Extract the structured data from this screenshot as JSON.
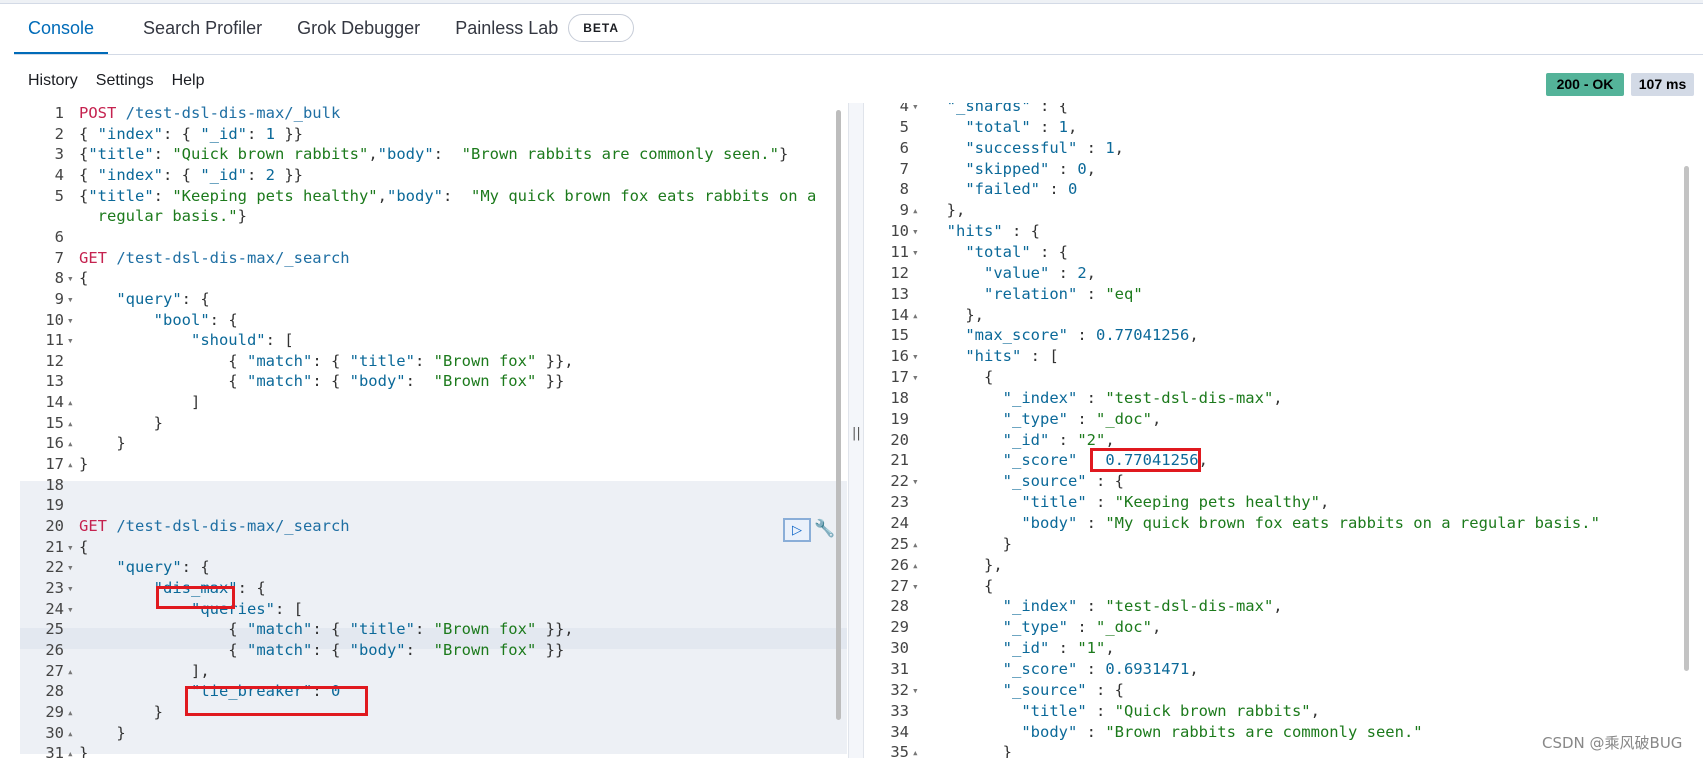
{
  "tabs": [
    {
      "label": "Console"
    },
    {
      "label": "Search Profiler"
    },
    {
      "label": "Grok Debugger"
    },
    {
      "label": "Painless Lab"
    }
  ],
  "beta_badge": "BETA",
  "toolbar": {
    "history": "History",
    "settings": "Settings",
    "help": "Help"
  },
  "status": {
    "code": "200 - OK",
    "time": "107 ms"
  },
  "splitter_grip": "||",
  "watermark": "CSDN @乘风破BUG",
  "icons": {
    "run": "play-icon",
    "wrench": "wrench-icon"
  },
  "colors": {
    "accent": "#006bb8",
    "ok": "#54b399",
    "highlight_box": "#e0191f"
  },
  "left_lines": [
    {
      "n": "1",
      "f": "",
      "t": [
        [
          "m",
          "POST"
        ],
        [
          "p",
          " /test-dsl-dis-max/_bulk"
        ]
      ]
    },
    {
      "n": "2",
      "f": "",
      "t": [
        [
          "b",
          "{ "
        ],
        [
          "k",
          "\"index\""
        ],
        [
          "b",
          ": { "
        ],
        [
          "k",
          "\"_id\""
        ],
        [
          "b",
          ": "
        ],
        [
          "n",
          "1"
        ],
        [
          "b",
          " }}"
        ]
      ]
    },
    {
      "n": "3",
      "f": "",
      "t": [
        [
          "b",
          "{"
        ],
        [
          "k",
          "\"title\""
        ],
        [
          "b",
          ": "
        ],
        [
          "s",
          "\"Quick brown rabbits\""
        ],
        [
          "b",
          ","
        ],
        [
          "k",
          "\"body\""
        ],
        [
          "b",
          ":  "
        ],
        [
          "s",
          "\"Brown rabbits are commonly seen.\""
        ],
        [
          "b",
          "}"
        ]
      ]
    },
    {
      "n": "4",
      "f": "",
      "t": [
        [
          "b",
          "{ "
        ],
        [
          "k",
          "\"index\""
        ],
        [
          "b",
          ": { "
        ],
        [
          "k",
          "\"_id\""
        ],
        [
          "b",
          ": "
        ],
        [
          "n",
          "2"
        ],
        [
          "b",
          " }}"
        ]
      ]
    },
    {
      "n": "5",
      "f": "",
      "t": [
        [
          "b",
          "{"
        ],
        [
          "k",
          "\"title\""
        ],
        [
          "b",
          ": "
        ],
        [
          "s",
          "\"Keeping pets healthy\""
        ],
        [
          "b",
          ","
        ],
        [
          "k",
          "\"body\""
        ],
        [
          "b",
          ":  "
        ],
        [
          "s",
          "\"My quick brown fox eats rabbits on a"
        ]
      ]
    },
    {
      "n": "",
      "f": "",
      "t": [
        [
          "s",
          "  regular basis.\""
        ],
        [
          "b",
          "}"
        ]
      ]
    },
    {
      "n": "6",
      "f": "",
      "t": []
    },
    {
      "n": "7",
      "f": "",
      "t": [
        [
          "m",
          "GET"
        ],
        [
          "p",
          " /test-dsl-dis-max/_search"
        ]
      ]
    },
    {
      "n": "8",
      "f": "▾",
      "t": [
        [
          "b",
          "{"
        ]
      ]
    },
    {
      "n": "9",
      "f": "▾",
      "t": [
        [
          "b",
          "    "
        ],
        [
          "k",
          "\"query\""
        ],
        [
          "b",
          ": {"
        ]
      ]
    },
    {
      "n": "10",
      "f": "▾",
      "t": [
        [
          "b",
          "        "
        ],
        [
          "k",
          "\"bool\""
        ],
        [
          "b",
          ": {"
        ]
      ]
    },
    {
      "n": "11",
      "f": "▾",
      "t": [
        [
          "b",
          "            "
        ],
        [
          "k",
          "\"should\""
        ],
        [
          "b",
          ": ["
        ]
      ]
    },
    {
      "n": "12",
      "f": "",
      "t": [
        [
          "b",
          "                { "
        ],
        [
          "k",
          "\"match\""
        ],
        [
          "b",
          ": { "
        ],
        [
          "k",
          "\"title\""
        ],
        [
          "b",
          ": "
        ],
        [
          "s",
          "\"Brown fox\""
        ],
        [
          "b",
          " }},"
        ]
      ]
    },
    {
      "n": "13",
      "f": "",
      "t": [
        [
          "b",
          "                { "
        ],
        [
          "k",
          "\"match\""
        ],
        [
          "b",
          ": { "
        ],
        [
          "k",
          "\"body\""
        ],
        [
          "b",
          ":  "
        ],
        [
          "s",
          "\"Brown fox\""
        ],
        [
          "b",
          " }}"
        ]
      ]
    },
    {
      "n": "14",
      "f": "▴",
      "t": [
        [
          "b",
          "            ]"
        ]
      ]
    },
    {
      "n": "15",
      "f": "▴",
      "t": [
        [
          "b",
          "        }"
        ]
      ]
    },
    {
      "n": "16",
      "f": "▴",
      "t": [
        [
          "b",
          "    }"
        ]
      ]
    },
    {
      "n": "17",
      "f": "▴",
      "t": [
        [
          "b",
          "}"
        ]
      ]
    },
    {
      "n": "18",
      "f": "",
      "t": []
    },
    {
      "n": "19",
      "f": "",
      "t": []
    },
    {
      "n": "20",
      "f": "",
      "t": [
        [
          "m",
          "GET"
        ],
        [
          "p",
          " /test-dsl-dis-max/_search"
        ]
      ]
    },
    {
      "n": "21",
      "f": "▾",
      "t": [
        [
          "b",
          "{"
        ]
      ]
    },
    {
      "n": "22",
      "f": "▾",
      "t": [
        [
          "b",
          "    "
        ],
        [
          "k",
          "\"query\""
        ],
        [
          "b",
          ": {"
        ]
      ]
    },
    {
      "n": "23",
      "f": "▾",
      "t": [
        [
          "b",
          "        "
        ],
        [
          "k",
          "\"dis_max\""
        ],
        [
          "b",
          ": {"
        ]
      ]
    },
    {
      "n": "24",
      "f": "▾",
      "t": [
        [
          "b",
          "            "
        ],
        [
          "k",
          "\"queries\""
        ],
        [
          "b",
          ": ["
        ]
      ]
    },
    {
      "n": "25",
      "f": "",
      "t": [
        [
          "b",
          "                { "
        ],
        [
          "k",
          "\"match\""
        ],
        [
          "b",
          ": { "
        ],
        [
          "k",
          "\"title\""
        ],
        [
          "b",
          ": "
        ],
        [
          "s",
          "\"Brown fox\""
        ],
        [
          "b",
          " }},"
        ]
      ]
    },
    {
      "n": "26",
      "f": "",
      "t": [
        [
          "b",
          "                { "
        ],
        [
          "k",
          "\"match\""
        ],
        [
          "b",
          ": { "
        ],
        [
          "k",
          "\"body\""
        ],
        [
          "b",
          ":  "
        ],
        [
          "s",
          "\"Brown fox\""
        ],
        [
          "b",
          " }}"
        ]
      ]
    },
    {
      "n": "27",
      "f": "▴",
      "t": [
        [
          "b",
          "            ],"
        ]
      ]
    },
    {
      "n": "28",
      "f": "",
      "t": [
        [
          "b",
          "            "
        ],
        [
          "k",
          "\"tie_breaker\""
        ],
        [
          "b",
          ": "
        ],
        [
          "n",
          "0"
        ]
      ]
    },
    {
      "n": "29",
      "f": "▴",
      "t": [
        [
          "b",
          "        }"
        ]
      ]
    },
    {
      "n": "30",
      "f": "▴",
      "t": [
        [
          "b",
          "    }"
        ]
      ]
    },
    {
      "n": "31",
      "f": "▴",
      "t": [
        [
          "b",
          "}"
        ]
      ]
    }
  ],
  "right_lines": [
    {
      "n": "4",
      "f": "▾",
      "t": [
        [
          "b",
          "  "
        ],
        [
          "k",
          "\"_shards\""
        ],
        [
          "b",
          " : {"
        ]
      ]
    },
    {
      "n": "5",
      "f": "",
      "t": [
        [
          "b",
          "    "
        ],
        [
          "k",
          "\"total\""
        ],
        [
          "b",
          " : "
        ],
        [
          "n",
          "1"
        ],
        [
          "b",
          ","
        ]
      ]
    },
    {
      "n": "6",
      "f": "",
      "t": [
        [
          "b",
          "    "
        ],
        [
          "k",
          "\"successful\""
        ],
        [
          "b",
          " : "
        ],
        [
          "n",
          "1"
        ],
        [
          "b",
          ","
        ]
      ]
    },
    {
      "n": "7",
      "f": "",
      "t": [
        [
          "b",
          "    "
        ],
        [
          "k",
          "\"skipped\""
        ],
        [
          "b",
          " : "
        ],
        [
          "n",
          "0"
        ],
        [
          "b",
          ","
        ]
      ]
    },
    {
      "n": "8",
      "f": "",
      "t": [
        [
          "b",
          "    "
        ],
        [
          "k",
          "\"failed\""
        ],
        [
          "b",
          " : "
        ],
        [
          "n",
          "0"
        ]
      ]
    },
    {
      "n": "9",
      "f": "▴",
      "t": [
        [
          "b",
          "  },"
        ]
      ]
    },
    {
      "n": "10",
      "f": "▾",
      "t": [
        [
          "b",
          "  "
        ],
        [
          "k",
          "\"hits\""
        ],
        [
          "b",
          " : {"
        ]
      ]
    },
    {
      "n": "11",
      "f": "▾",
      "t": [
        [
          "b",
          "    "
        ],
        [
          "k",
          "\"total\""
        ],
        [
          "b",
          " : {"
        ]
      ]
    },
    {
      "n": "12",
      "f": "",
      "t": [
        [
          "b",
          "      "
        ],
        [
          "k",
          "\"value\""
        ],
        [
          "b",
          " : "
        ],
        [
          "n",
          "2"
        ],
        [
          "b",
          ","
        ]
      ]
    },
    {
      "n": "13",
      "f": "",
      "t": [
        [
          "b",
          "      "
        ],
        [
          "k",
          "\"relation\""
        ],
        [
          "b",
          " : "
        ],
        [
          "s",
          "\"eq\""
        ]
      ]
    },
    {
      "n": "14",
      "f": "▴",
      "t": [
        [
          "b",
          "    },"
        ]
      ]
    },
    {
      "n": "15",
      "f": "",
      "t": [
        [
          "b",
          "    "
        ],
        [
          "k",
          "\"max_score\""
        ],
        [
          "b",
          " : "
        ],
        [
          "n",
          "0.77041256"
        ],
        [
          "b",
          ","
        ]
      ]
    },
    {
      "n": "16",
      "f": "▾",
      "t": [
        [
          "b",
          "    "
        ],
        [
          "k",
          "\"hits\""
        ],
        [
          "b",
          " : ["
        ]
      ]
    },
    {
      "n": "17",
      "f": "▾",
      "t": [
        [
          "b",
          "      {"
        ]
      ]
    },
    {
      "n": "18",
      "f": "",
      "t": [
        [
          "b",
          "        "
        ],
        [
          "k",
          "\"_index\""
        ],
        [
          "b",
          " : "
        ],
        [
          "s",
          "\"test-dsl-dis-max\""
        ],
        [
          "b",
          ","
        ]
      ]
    },
    {
      "n": "19",
      "f": "",
      "t": [
        [
          "b",
          "        "
        ],
        [
          "k",
          "\"_type\""
        ],
        [
          "b",
          " : "
        ],
        [
          "s",
          "\"_doc\""
        ],
        [
          "b",
          ","
        ]
      ]
    },
    {
      "n": "20",
      "f": "",
      "t": [
        [
          "b",
          "        "
        ],
        [
          "k",
          "\"_id\""
        ],
        [
          "b",
          " : "
        ],
        [
          "s",
          "\"2\""
        ],
        [
          "b",
          ","
        ]
      ]
    },
    {
      "n": "21",
      "f": "",
      "t": [
        [
          "b",
          "        "
        ],
        [
          "k",
          "\"_score\""
        ],
        [
          "b",
          " : "
        ],
        [
          "n",
          "0.77041256"
        ],
        [
          "b",
          ","
        ]
      ]
    },
    {
      "n": "22",
      "f": "▾",
      "t": [
        [
          "b",
          "        "
        ],
        [
          "k",
          "\"_source\""
        ],
        [
          "b",
          " : {"
        ]
      ]
    },
    {
      "n": "23",
      "f": "",
      "t": [
        [
          "b",
          "          "
        ],
        [
          "k",
          "\"title\""
        ],
        [
          "b",
          " : "
        ],
        [
          "s",
          "\"Keeping pets healthy\""
        ],
        [
          "b",
          ","
        ]
      ]
    },
    {
      "n": "24",
      "f": "",
      "t": [
        [
          "b",
          "          "
        ],
        [
          "k",
          "\"body\""
        ],
        [
          "b",
          " : "
        ],
        [
          "s",
          "\"My quick brown fox eats rabbits on a regular basis.\""
        ]
      ]
    },
    {
      "n": "25",
      "f": "▴",
      "t": [
        [
          "b",
          "        }"
        ]
      ]
    },
    {
      "n": "26",
      "f": "▴",
      "t": [
        [
          "b",
          "      },"
        ]
      ]
    },
    {
      "n": "27",
      "f": "▾",
      "t": [
        [
          "b",
          "      {"
        ]
      ]
    },
    {
      "n": "28",
      "f": "",
      "t": [
        [
          "b",
          "        "
        ],
        [
          "k",
          "\"_index\""
        ],
        [
          "b",
          " : "
        ],
        [
          "s",
          "\"test-dsl-dis-max\""
        ],
        [
          "b",
          ","
        ]
      ]
    },
    {
      "n": "29",
      "f": "",
      "t": [
        [
          "b",
          "        "
        ],
        [
          "k",
          "\"_type\""
        ],
        [
          "b",
          " : "
        ],
        [
          "s",
          "\"_doc\""
        ],
        [
          "b",
          ","
        ]
      ]
    },
    {
      "n": "30",
      "f": "",
      "t": [
        [
          "b",
          "        "
        ],
        [
          "k",
          "\"_id\""
        ],
        [
          "b",
          " : "
        ],
        [
          "s",
          "\"1\""
        ],
        [
          "b",
          ","
        ]
      ]
    },
    {
      "n": "31",
      "f": "",
      "t": [
        [
          "b",
          "        "
        ],
        [
          "k",
          "\"_score\""
        ],
        [
          "b",
          " : "
        ],
        [
          "n",
          "0.6931471"
        ],
        [
          "b",
          ","
        ]
      ]
    },
    {
      "n": "32",
      "f": "▾",
      "t": [
        [
          "b",
          "        "
        ],
        [
          "k",
          "\"_source\""
        ],
        [
          "b",
          " : {"
        ]
      ]
    },
    {
      "n": "33",
      "f": "",
      "t": [
        [
          "b",
          "          "
        ],
        [
          "k",
          "\"title\""
        ],
        [
          "b",
          " : "
        ],
        [
          "s",
          "\"Quick brown rabbits\""
        ],
        [
          "b",
          ","
        ]
      ]
    },
    {
      "n": "34",
      "f": "",
      "t": [
        [
          "b",
          "          "
        ],
        [
          "k",
          "\"body\""
        ],
        [
          "b",
          " : "
        ],
        [
          "s",
          "\"Brown rabbits are commonly seen.\""
        ]
      ]
    },
    {
      "n": "35",
      "f": "▴",
      "t": [
        [
          "b",
          "        }"
        ]
      ]
    }
  ]
}
